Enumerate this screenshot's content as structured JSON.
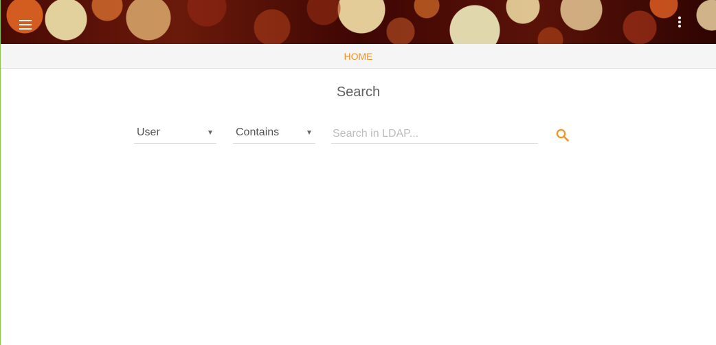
{
  "header": {
    "menu_icon": "menu-icon",
    "more_icon": "more-vert-icon"
  },
  "nav": {
    "home_label": "HOME"
  },
  "main": {
    "title": "Search",
    "type_select": {
      "value": "User"
    },
    "operator_select": {
      "value": "Contains"
    },
    "search": {
      "placeholder": "Search in LDAP...",
      "value": ""
    },
    "search_icon": "search-icon"
  },
  "colors": {
    "accent": "#f5921f",
    "left_border": "#8bc34a",
    "tabbar_background": "#f5f5f5",
    "title_text": "#616161"
  }
}
